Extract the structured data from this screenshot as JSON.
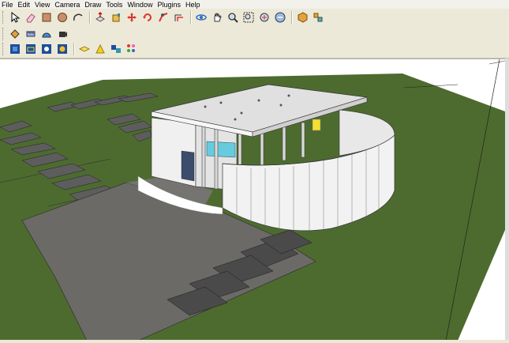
{
  "menu": [
    "File",
    "Edit",
    "View",
    "Camera",
    "Draw",
    "Tools",
    "Window",
    "Plugins",
    "Help"
  ],
  "toolbar1": [
    "select-icon",
    "eraser-icon",
    "rectangle-icon",
    "circle-icon",
    "arc-icon",
    "push-pull-icon",
    "paint-bucket-icon",
    "move-icon",
    "rotate-icon",
    "follow-me-icon",
    "offset-icon",
    "orbit-icon",
    "pan-icon",
    "zoom-icon",
    "zoom-window-icon",
    "zoom-extents-icon",
    "previous-view-icon",
    "get-models-icon",
    "components-icon"
  ],
  "toolbar2": [
    "section-plane-icon",
    "tape-measure-icon",
    "protractor-icon",
    "camera-position-icon"
  ],
  "toolbar3": [
    "xray-icon",
    "wireframe-icon",
    "hidden-line-icon",
    "shaded-icon",
    "shaded-textures-icon",
    "monochrome-icon",
    "shadows-icon",
    "fog-icon"
  ],
  "colors": {
    "grass": "#4c6c2e",
    "road": "#6b6a66",
    "building": "#f2f2f2",
    "accent": "#66ccdd"
  }
}
